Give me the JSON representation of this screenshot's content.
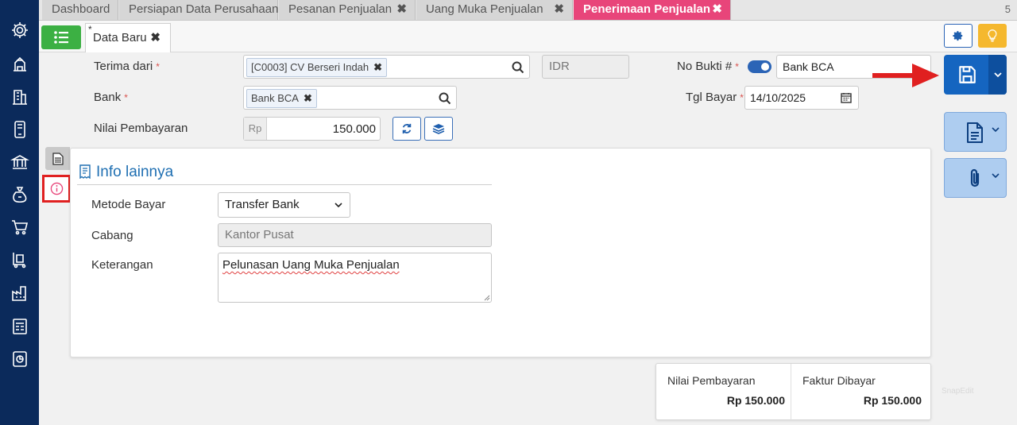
{
  "tabs": {
    "items": [
      {
        "label": "Dashboard"
      },
      {
        "label": "Persiapan Data Perusahaan"
      },
      {
        "label": "Pesanan Penjualan"
      },
      {
        "label": "Uang Muka Penjualan"
      },
      {
        "label": "Penerimaan Penjualan"
      }
    ],
    "close_glyph": "✖",
    "count": "5"
  },
  "subtab": {
    "label": "Data Baru",
    "modified_mark": "*",
    "close_glyph": "✖"
  },
  "sidebar": {
    "icons": [
      "settings-icon",
      "building-icon",
      "office-icon",
      "device-icon",
      "bank-icon",
      "money-bag-icon",
      "cart-icon",
      "trolley-icon",
      "factory-icon",
      "tax-icon",
      "report-icon"
    ]
  },
  "form": {
    "terima_dari": {
      "label": "Terima dari",
      "required": "*",
      "value": "[C0003] CV Berseri Indah",
      "remove": "✖"
    },
    "currency": {
      "value": "IDR"
    },
    "bank": {
      "label": "Bank",
      "required": "*",
      "value": "Bank BCA",
      "remove": "✖"
    },
    "nilai": {
      "label": "Nilai Pembayaran",
      "prefix": "Rp",
      "value": "150.000"
    },
    "no_bukti": {
      "label": "No Bukti #",
      "required": "*",
      "value": "Bank BCA"
    },
    "tgl_bayar": {
      "label": "Tgl Bayar",
      "required": "*",
      "value": "14/10/2025"
    }
  },
  "info": {
    "title": "Info lainnya",
    "metode": {
      "label": "Metode Bayar",
      "value": "Transfer Bank"
    },
    "cabang": {
      "label": "Cabang",
      "value": "Kantor Pusat"
    },
    "keterangan": {
      "label": "Keterangan",
      "value": "Pelunasan Uang Muka Penjualan"
    }
  },
  "summary": {
    "nilai": {
      "label": "Nilai Pembayaran",
      "value": "Rp 150.000"
    },
    "faktur": {
      "label": "Faktur Dibayar",
      "value": "Rp 150.000"
    }
  },
  "watermark": "SnapEdit",
  "colors": {
    "sidebar": "#0b2a5b",
    "active_tab": "#e8457a",
    "primary": "#1565c0",
    "success": "#3cb043",
    "warning": "#f5b82e",
    "highlight": "#e02020"
  }
}
